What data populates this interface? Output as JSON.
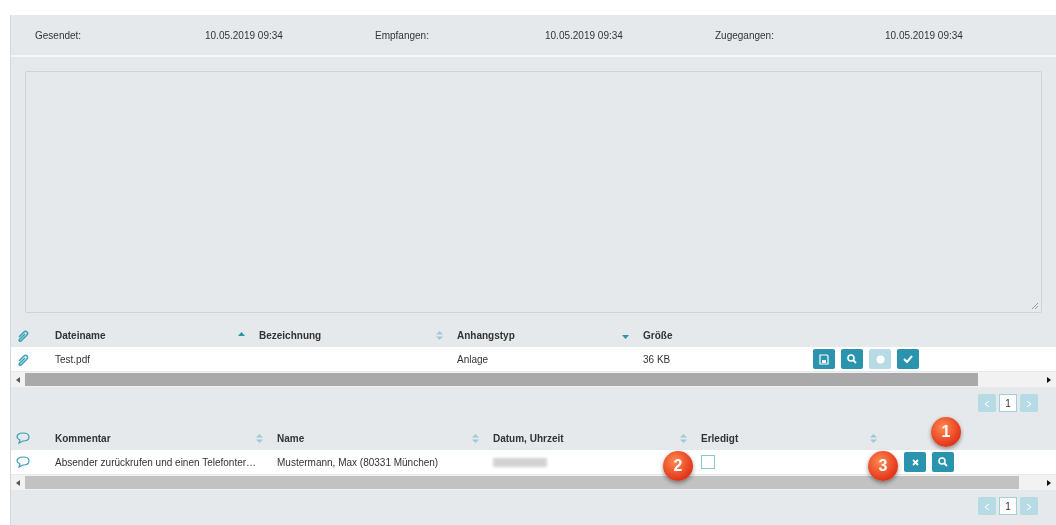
{
  "header": [
    {
      "label": "Gesendet:",
      "value": "10.05.2019 09:34"
    },
    {
      "label": "Empfangen:",
      "value": "10.05.2019 09:34"
    },
    {
      "label": "Zugegangen:",
      "value": "10.05.2019 09:34"
    }
  ],
  "attachments": {
    "columns": [
      {
        "label": "Dateiname",
        "kind": "ascending"
      },
      {
        "label": "Bezeichnung",
        "kind": "sortable"
      },
      {
        "label": "Anhangstyp",
        "kind": "descending"
      },
      {
        "label": "Größe",
        "kind": "plain"
      }
    ],
    "rows": [
      {
        "cells": [
          "Test.pdf",
          "",
          "Anlage",
          "36 KB"
        ],
        "actions": [
          {
            "kind": "save",
            "disabled": false
          },
          {
            "kind": "search",
            "disabled": false
          },
          {
            "kind": "circle",
            "disabled": true
          },
          {
            "kind": "check",
            "disabled": false
          }
        ]
      }
    ],
    "pager": {
      "page": "1"
    }
  },
  "comments": {
    "columns": [
      {
        "label": "Kommentar",
        "kind": "sortable"
      },
      {
        "label": "Name",
        "kind": "sortable"
      },
      {
        "label": "Datum, Uhrzeit",
        "kind": "sortable"
      },
      {
        "label": "Erledigt",
        "kind": "sortable"
      }
    ],
    "rows": [
      {
        "comment": "Absender zurückrufen und einen Telefonter…",
        "name": "Mustermann, Max (80331 München)",
        "done": false,
        "actions": [
          {
            "kind": "delete",
            "disabled": false
          },
          {
            "kind": "search",
            "disabled": false
          }
        ]
      }
    ],
    "pager": {
      "page": "1"
    }
  },
  "callouts": [
    {
      "label": "1"
    },
    {
      "label": "2"
    },
    {
      "label": "3"
    }
  ]
}
